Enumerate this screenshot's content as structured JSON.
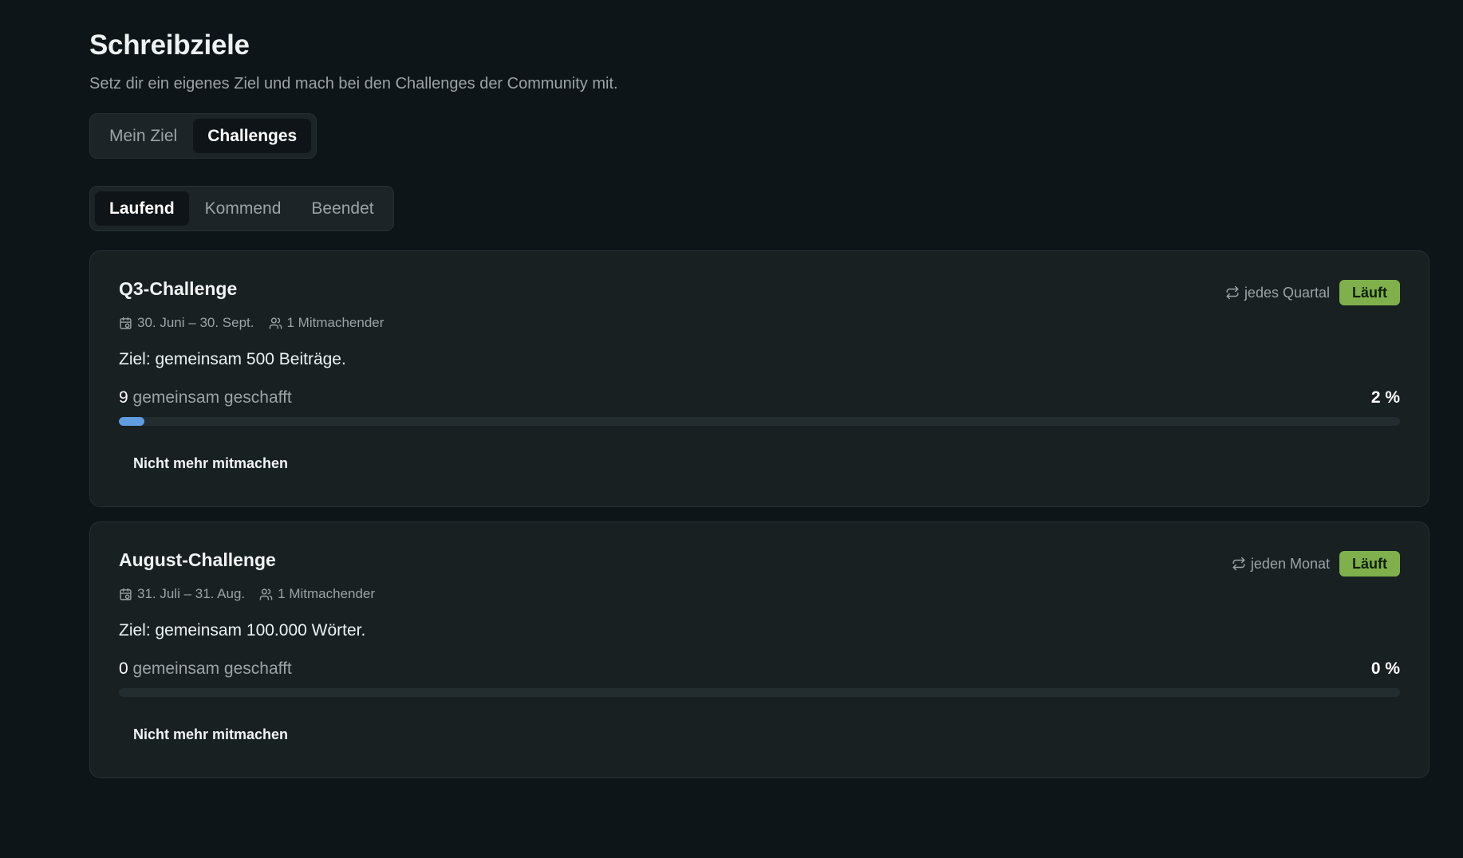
{
  "header": {
    "title": "Schreibziele",
    "subtitle": "Setz dir ein eigenes Ziel und mach bei den Challenges der Community mit."
  },
  "main_tabs": [
    {
      "label": "Mein Ziel",
      "active": false
    },
    {
      "label": "Challenges",
      "active": true
    }
  ],
  "sub_tabs": [
    {
      "label": "Laufend",
      "active": true
    },
    {
      "label": "Kommend",
      "active": false
    },
    {
      "label": "Beendet",
      "active": false
    }
  ],
  "colors": {
    "accent_progress": "#5f9de0",
    "status_running": "#7fb04b"
  },
  "challenges": [
    {
      "title": "Q3-Challenge",
      "recurrence": "jedes Quartal",
      "status": "Läuft",
      "dates": "30. Juni – 30. Sept.",
      "participants": "1 Mitmachender",
      "goal": "Ziel: gemeinsam 500 Beiträge.",
      "count": "9",
      "count_label": "gemeinsam geschafft",
      "percent_label": "2 %",
      "progress": 0.02,
      "leave_label": "Nicht mehr mitmachen",
      "icons": {
        "recurrence": "repeat-icon",
        "dates": "calendar-icon",
        "participants": "users-icon"
      }
    },
    {
      "title": "August-Challenge",
      "recurrence": "jeden Monat",
      "status": "Läuft",
      "dates": "31. Juli – 31. Aug.",
      "participants": "1 Mitmachender",
      "goal": "Ziel: gemeinsam 100.000 Wörter.",
      "count": "0",
      "count_label": "gemeinsam geschafft",
      "percent_label": "0 %",
      "progress": 0.0,
      "leave_label": "Nicht mehr mitmachen",
      "icons": {
        "recurrence": "repeat-icon",
        "dates": "calendar-icon",
        "participants": "users-icon"
      }
    }
  ]
}
